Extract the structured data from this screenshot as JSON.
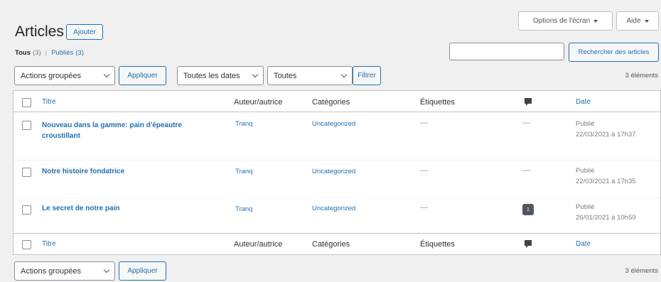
{
  "header": {
    "title": "Articles",
    "add_label": "Ajouter",
    "screen_options_label": "Options de l'écran",
    "help_label": "Aide"
  },
  "subsubsub": {
    "all_label": "Tous",
    "all_count": "(3)",
    "separator": "|",
    "published_label": "Publiés",
    "published_count": "(3)"
  },
  "search": {
    "value": "",
    "button_label": "Rechercher des articles"
  },
  "tablenav_top": {
    "bulk_actions": "Actions groupées",
    "apply_label": "Appliquer",
    "dates_filter": "Toutes les dates",
    "category_filter": "Toutes",
    "filter_label": "Filtrer",
    "count": "3 éléments"
  },
  "columns": {
    "title": "Titre",
    "author": "Auteur/autrice",
    "categories": "Catégories",
    "tags": "Étiquettes",
    "comments_icon": "comment-bubble-icon",
    "date": "Date"
  },
  "rows": [
    {
      "title_line1": "Nouveau dans la gamme: pain d'épeautre",
      "title_line2": "croustillant",
      "author": "Tranq",
      "category": "Uncategorized",
      "tags": "—",
      "comments": "—",
      "status": "Publié",
      "date": "22/03/2021 à 17h37"
    },
    {
      "title_line1": "Notre histoire fondatrice",
      "author": "Tranq",
      "category": "Uncategorized",
      "tags": "—",
      "comments": "—",
      "status": "Publié",
      "date": "22/03/2021 à 17h35"
    },
    {
      "title_line1": "Le secret de notre pain",
      "author": "Tranq",
      "category": "Uncategorized",
      "tags": "—",
      "comments": "1",
      "status": "Publié",
      "date": "26/01/2021 à 10h59"
    }
  ],
  "tablenav_bottom": {
    "bulk_actions": "Actions groupées",
    "apply_label": "Appliquer",
    "count": "3 éléments"
  },
  "colors": {
    "link": "#2271b1",
    "border": "#c3c4c7",
    "background": "#f0f0f1"
  }
}
